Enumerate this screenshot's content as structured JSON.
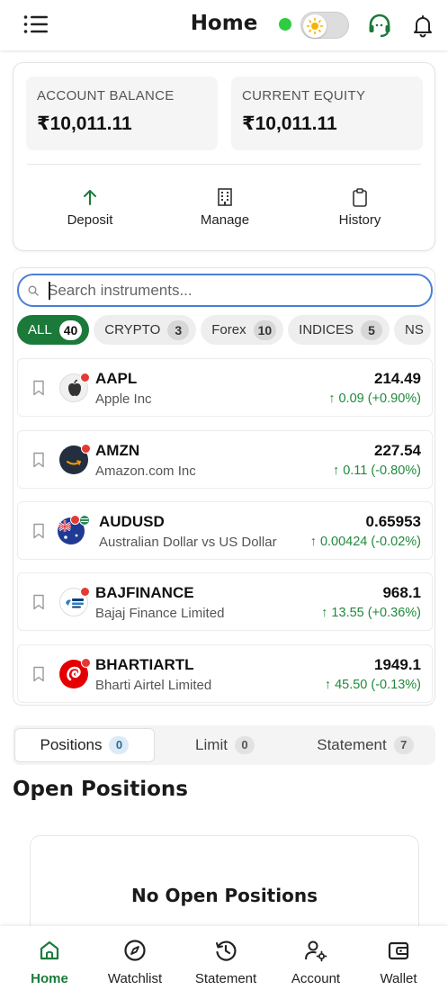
{
  "header": {
    "title": "Home"
  },
  "account": {
    "balance_label": "ACCOUNT BALANCE",
    "balance_value": "₹10,011.11",
    "equity_label": "CURRENT EQUITY",
    "equity_value": "₹10,011.11",
    "actions": [
      "Deposit",
      "Manage",
      "History"
    ]
  },
  "search": {
    "placeholder": "Search instruments..."
  },
  "filters": [
    {
      "label": "ALL",
      "count": "40",
      "active": true
    },
    {
      "label": "CRYPTO",
      "count": "3"
    },
    {
      "label": "Forex",
      "count": "10"
    },
    {
      "label": "INDICES",
      "count": "5"
    },
    {
      "label": "NS",
      "count": ""
    }
  ],
  "instruments": [
    {
      "symbol": "AAPL",
      "name": "Apple Inc",
      "price": "214.49",
      "change": "↑ 0.09 (+0.90%)"
    },
    {
      "symbol": "AMZN",
      "name": "Amazon.com Inc",
      "price": "227.54",
      "change": "↑ 0.11 (-0.80%)"
    },
    {
      "symbol": "AUDUSD",
      "name": "Australian Dollar vs US Dollar",
      "price": "0.65953",
      "change": "↑ 0.00424 (-0.02%)"
    },
    {
      "symbol": "BAJFINANCE",
      "name": "Bajaj Finance Limited",
      "price": "968.1",
      "change": "↑ 13.55 (+0.36%)"
    },
    {
      "symbol": "BHARTIARTL",
      "name": "Bharti Airtel Limited",
      "price": "1949.1",
      "change": "↑ 45.50 (-0.13%)"
    }
  ],
  "tabs": [
    {
      "label": "Positions",
      "count": "0"
    },
    {
      "label": "Limit",
      "count": "0"
    },
    {
      "label": "Statement",
      "count": "7"
    }
  ],
  "positions": {
    "title": "Open Positions",
    "empty": "No Open Positions"
  },
  "nav": [
    "Home",
    "Watchlist",
    "Statement",
    "Account",
    "Wallet"
  ],
  "colors": {
    "accent": "#1b7a3a",
    "positive": "#1f8a3b",
    "focus": "#4a7fd6",
    "online": "#2ecc40"
  }
}
